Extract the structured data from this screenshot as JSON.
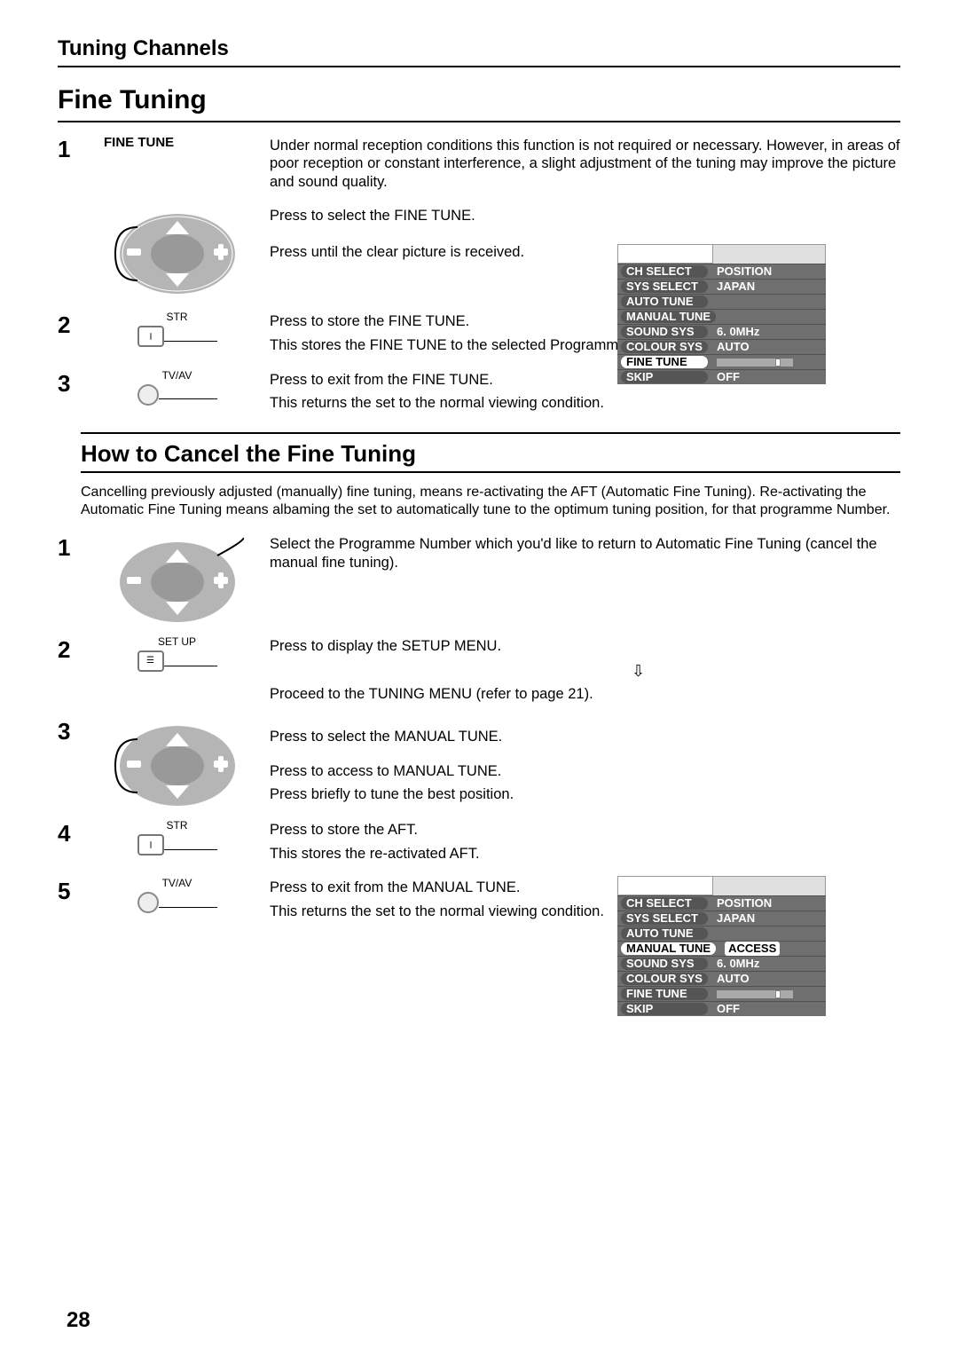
{
  "header": "Tuning Channels",
  "titleA": "Fine Tuning",
  "titleB": "How to Cancel the Fine Tuning",
  "page_number": "28",
  "A": {
    "s1": {
      "num": "1",
      "label": "FINE TUNE",
      "intro": "Under normal reception conditions this function is not required or necessary. However, in areas of poor reception or constant interference, a slight adjustment of the tuning may improve the picture and sound quality.",
      "line1": "Press to select the FINE TUNE.",
      "line2": "Press until the clear picture is received."
    },
    "s2": {
      "num": "2",
      "icon_label": "STR",
      "line1": "Press to store the FINE TUNE.",
      "line2": "This stores the FINE TUNE to the selected Programme Number."
    },
    "s3": {
      "num": "3",
      "icon_label": "TV/AV",
      "line1": "Press to exit from the FINE TUNE.",
      "line2": "This returns the set to the normal viewing condition."
    }
  },
  "cancel_intro": "Cancelling previously adjusted (manually) fine tuning, means re-activating the AFT (Automatic Fine Tuning). Re-activating the Automatic Fine Tuning means albaming the set to automatically tune to the optimum tuning position, for that programme Number.",
  "B": {
    "s1": {
      "num": "1",
      "line1": "Select the Programme Number which you'd like to return to Automatic Fine Tuning (cancel the manual fine tuning)."
    },
    "s2": {
      "num": "2",
      "icon_label": "SET UP",
      "line1": "Press to display the SETUP MENU.",
      "line2": "Proceed to the TUNING MENU (refer to page 21)."
    },
    "s3": {
      "num": "3",
      "line1": "Press to select the MANUAL TUNE.",
      "line2": "Press to access to MANUAL TUNE.",
      "line3": "Press briefly to tune the best position."
    },
    "s4": {
      "num": "4",
      "icon_label": "STR",
      "line1": "Press to store the AFT.",
      "line2": "This stores the re-activated AFT."
    },
    "s5": {
      "num": "5",
      "icon_label": "TV/AV",
      "line1": "Press to exit from the MANUAL TUNE.",
      "line2": "This returns the set to the normal viewing condition."
    }
  },
  "osd_menu1": {
    "rows": [
      {
        "label": "CH  SELECT",
        "value": "POSITION"
      },
      {
        "label": "SYS SELECT",
        "value": "JAPAN"
      },
      {
        "label": "AUTO TUNE",
        "value": ""
      },
      {
        "label": "MANUAL TUNE",
        "value": ""
      },
      {
        "label": "SOUND SYS",
        "value": "6. 0MHz"
      },
      {
        "label": "COLOUR SYS",
        "value": "AUTO"
      },
      {
        "label": "FINE TUNE",
        "value": ""
      },
      {
        "label": "SKIP",
        "value": "OFF"
      }
    ],
    "hl_index": 6
  },
  "osd_menu2": {
    "rows": [
      {
        "label": "CH  SELECT",
        "value": "POSITION"
      },
      {
        "label": "SYS SELECT",
        "value": "JAPAN"
      },
      {
        "label": "AUTO TUNE",
        "value": ""
      },
      {
        "label": "MANUAL TUNE",
        "value": "ACCESS"
      },
      {
        "label": "SOUND SYS",
        "value": "6. 0MHz"
      },
      {
        "label": "COLOUR SYS",
        "value": "AUTO"
      },
      {
        "label": "FINE TUNE",
        "value": ""
      },
      {
        "label": "SKIP",
        "value": "OFF"
      }
    ],
    "hl_index": 3
  }
}
